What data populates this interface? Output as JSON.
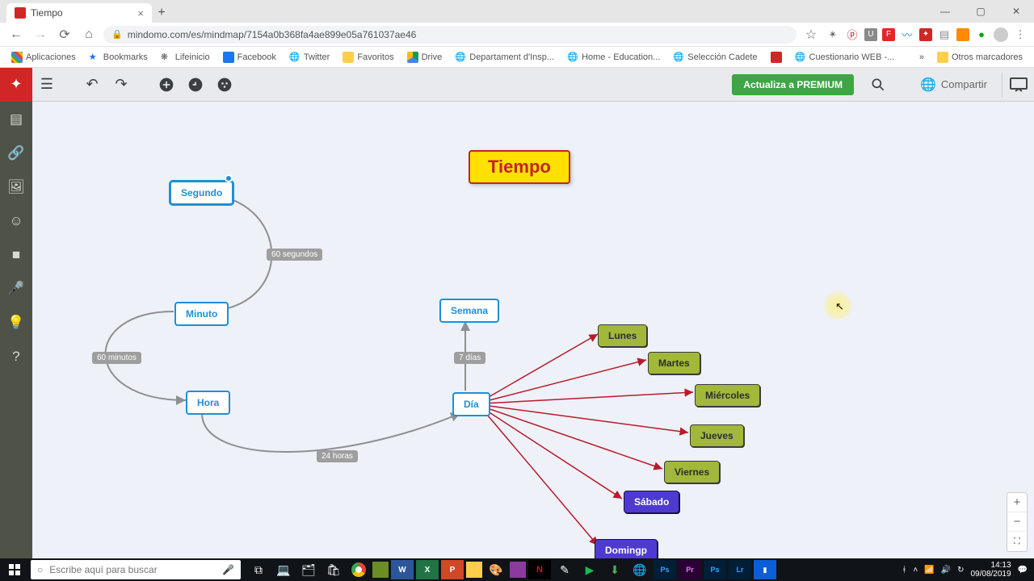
{
  "browser": {
    "tab_title": "Tiempo",
    "url": "mindomo.com/es/mindmap/7154a0b368fa4ae899e05a761037ae46",
    "bookmarks": {
      "apps": "Aplicaciones",
      "items": [
        "Bookmarks",
        "Lifeinicio",
        "Facebook",
        "Twitter",
        "Favoritos",
        "Drive",
        "Departament d'Insp...",
        "Home - Education...",
        "Selección Cadete",
        "Cuestionario WEB -..."
      ],
      "more": "»",
      "other": "Otros marcadores"
    }
  },
  "app": {
    "premium_label": "Actualiza a PREMIUM",
    "share_label": "Compartir"
  },
  "map": {
    "title": "Tiempo",
    "time_units": {
      "segundo": "Segundo",
      "minuto": "Minuto",
      "hora": "Hora",
      "dia": "Día",
      "semana": "Semana"
    },
    "edge_labels": {
      "sixty_seconds": "60 segundos",
      "sixty_minutes": "60 minutos",
      "twentyfour_hours": "24 horas",
      "seven_days": "7 días"
    },
    "days": {
      "lunes": "Lunes",
      "martes": "Martes",
      "miercoles": "Miércoles",
      "jueves": "Jueves",
      "viernes": "Viernes",
      "sabado": "Sábado",
      "domingo": "Domingp"
    }
  },
  "taskbar": {
    "search_placeholder": "Escribe aquí para buscar",
    "time": "14:13",
    "date": "09/08/2019"
  }
}
